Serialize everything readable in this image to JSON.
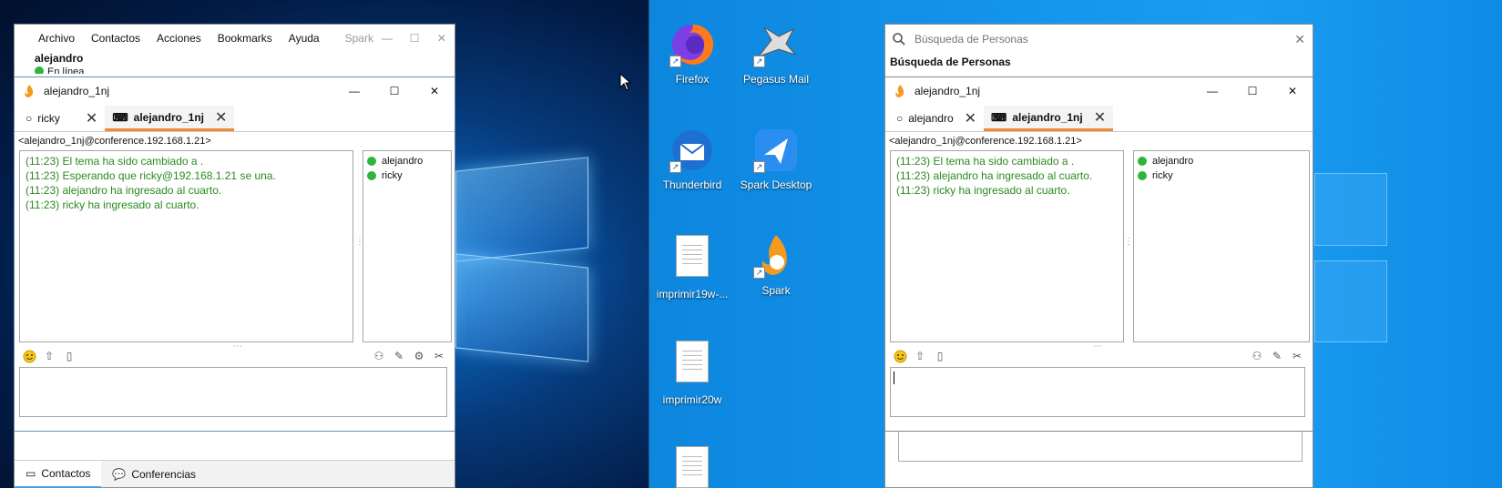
{
  "left_window": {
    "menu": [
      "Archivo",
      "Contactos",
      "Acciones",
      "Bookmarks",
      "Ayuda"
    ],
    "app_name": "Spark",
    "user": "alejandro",
    "status": "En línea",
    "bottom_tabs": [
      "Contactos",
      "Conferencias"
    ]
  },
  "left_chat": {
    "title": "alejandro_1nj",
    "tabs": [
      {
        "label": "ricky",
        "active": false
      },
      {
        "label": "alejandro_1nj",
        "active": true
      }
    ],
    "room_jid": "<alejandro_1nj@conference.192.168.1.21>",
    "messages": [
      "(11:23) El tema ha sido cambiado a .",
      "(11:23) Esperando que ricky@192.168.1.21 se una.",
      "(11:23) alejandro ha ingresado al cuarto.",
      "(11:23) ricky ha ingresado al cuarto."
    ],
    "occupants": [
      "alejandro",
      "ricky"
    ],
    "input_value": ""
  },
  "search_window": {
    "search_placeholder": "Búsqueda de Personas",
    "heading": "Búsqueda de Personas"
  },
  "right_chat": {
    "title": "alejandro_1nj",
    "tabs": [
      {
        "label": "alejandro",
        "active": false
      },
      {
        "label": "alejandro_1nj",
        "active": true
      }
    ],
    "room_jid": "<alejandro_1nj@conference.192.168.1.21>",
    "messages": [
      "(11:23) El tema ha sido cambiado a .",
      "(11:23) alejandro ha ingresado al cuarto.",
      "(11:23) ricky ha ingresado al cuarto."
    ],
    "occupants": [
      "alejandro",
      "ricky"
    ],
    "input_value": ""
  },
  "desktop_icons": [
    {
      "label": "Firefox",
      "icon": "firefox-icon"
    },
    {
      "label": "Pegasus Mail",
      "icon": "pegasus-icon"
    },
    {
      "label": "Thunderbird",
      "icon": "thunderbird-icon"
    },
    {
      "label": "Spark Desktop",
      "icon": "spark-desktop-icon"
    },
    {
      "label": "imprimir19w-...",
      "icon": "document-icon"
    },
    {
      "label": "Spark",
      "icon": "spark-icon"
    },
    {
      "label": "imprimir20w",
      "icon": "document-icon"
    },
    {
      "label": "",
      "icon": "document-icon"
    }
  ],
  "colors": {
    "accent": "#f08a35",
    "message_green": "#2a8a1f",
    "online_dot": "#2fb53a"
  }
}
